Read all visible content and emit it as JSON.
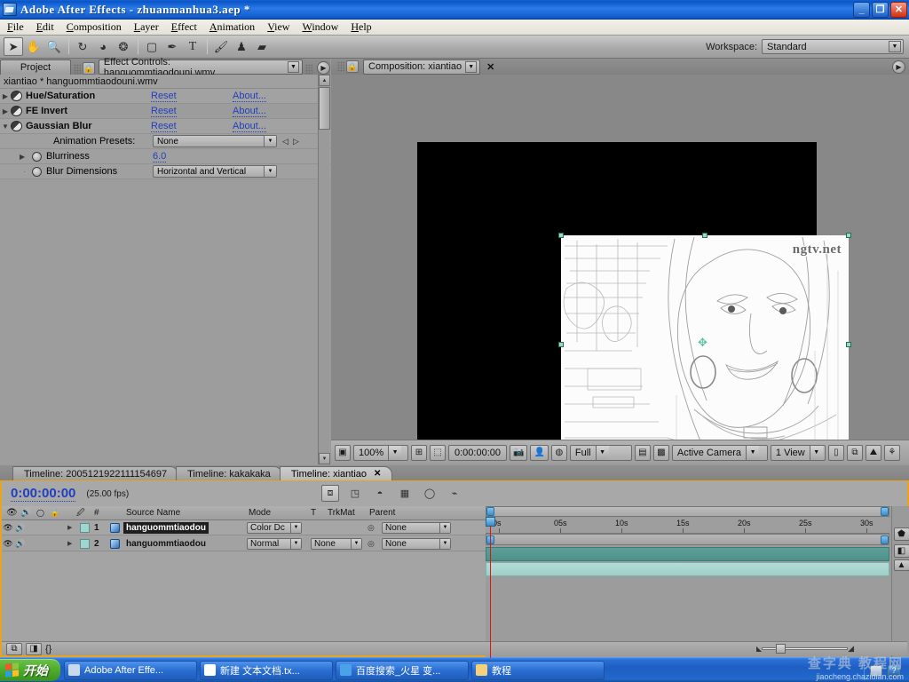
{
  "window": {
    "title": "Adobe After Effects - zhuanmanhua3.aep *",
    "minimize": "_",
    "restore": "❐",
    "close": "✕"
  },
  "menubar": {
    "items": [
      "File",
      "Edit",
      "Composition",
      "Layer",
      "Effect",
      "Animation",
      "View",
      "Window",
      "Help"
    ]
  },
  "toolbar": {
    "tools": [
      {
        "name": "selection-tool",
        "glyph": "➤"
      },
      {
        "name": "hand-tool",
        "glyph": "✋"
      },
      {
        "name": "zoom-tool",
        "glyph": "🔍"
      },
      {
        "name": "rotation-tool",
        "glyph": "↻"
      },
      {
        "name": "orbit-camera-tool",
        "glyph": "◕"
      },
      {
        "name": "pan-behind-tool",
        "glyph": "❂"
      },
      {
        "name": "shape-tool",
        "glyph": "▢"
      },
      {
        "name": "pen-tool",
        "glyph": "✒"
      },
      {
        "name": "text-tool",
        "glyph": "T"
      },
      {
        "name": "brush-tool",
        "glyph": "🖌"
      },
      {
        "name": "clone-stamp-tool",
        "glyph": "♟"
      },
      {
        "name": "eraser-tool",
        "glyph": "▰"
      }
    ],
    "workspace_label": "Workspace:",
    "workspace_value": "Standard"
  },
  "left_panel": {
    "tab_project": "Project",
    "tab_effect_controls": "Effect Controls: hanguommtiaodouni.wmv",
    "header": "xiantiao * hanguommtiaodouni.wmv",
    "columns": {
      "reset": "Reset",
      "about": "About..."
    },
    "effects": [
      {
        "name": "Hue/Saturation",
        "expanded": false,
        "reset": "Reset",
        "about": "About..."
      },
      {
        "name": "FE Invert",
        "expanded": false,
        "reset": "Reset",
        "about": "About..."
      },
      {
        "name": "Gaussian Blur",
        "expanded": true,
        "reset": "Reset",
        "about": "About..."
      }
    ],
    "animation_presets": {
      "label": "Animation Presets:",
      "value": "None"
    },
    "properties": [
      {
        "name": "Blurriness",
        "value": "6.0",
        "type": "number"
      },
      {
        "name": "Blur Dimensions",
        "value": "Horizontal and Vertical",
        "type": "dropdown"
      }
    ]
  },
  "comp_panel": {
    "tab": "Composition: xiantiao",
    "close": "✕",
    "image_watermark": "ngtv.net",
    "controls": {
      "magnification": "100%",
      "current_time": "0:00:00:00",
      "resolution": "Full",
      "view": "Active Camera",
      "view_layout": "1 View"
    }
  },
  "timeline": {
    "tabs": [
      {
        "label": "Timeline: 2005121922111154697",
        "active": false
      },
      {
        "label": "Timeline: kakakaka",
        "active": false
      },
      {
        "label": "Timeline: xiantiao",
        "active": true,
        "close": "✕"
      }
    ],
    "current_time": "0:00:00:00",
    "fps": "(25.00 fps)",
    "columns": [
      "#",
      "Source Name",
      "Mode",
      "T",
      "TrkMat",
      "Parent"
    ],
    "layers": [
      {
        "index": "1",
        "source": "hanguommtiaodou",
        "mode": "Color Dc",
        "trkmat": "",
        "parent": "None",
        "selected": true
      },
      {
        "index": "2",
        "source": "hanguommtiaodou",
        "mode": "Normal",
        "trkmat": "None",
        "parent": "None",
        "selected": false
      }
    ],
    "ruler_labels": [
      "0s",
      "05s",
      "10s",
      "15s",
      "20s",
      "25s",
      "30s"
    ]
  },
  "taskbar": {
    "start": "开始",
    "items": [
      {
        "label": "Adobe After Effe...",
        "icon_color": "#c9d9ee"
      },
      {
        "label": "新建 文本文档.tx...",
        "icon_color": "#ffffff"
      },
      {
        "label": "百度搜索_火星 变...",
        "icon_color": "#4aa3e8"
      },
      {
        "label": "教程",
        "icon_color": "#f5d27a"
      }
    ],
    "watermark_title": "查字典 教程网",
    "watermark_url": "jiaocheng.chazidian.com"
  },
  "colors": {
    "accent_blue": "#2040c0",
    "timeline_border": "#e8a41c",
    "panel_gray": "#9a9a9a",
    "cti_red": "#d81616"
  }
}
